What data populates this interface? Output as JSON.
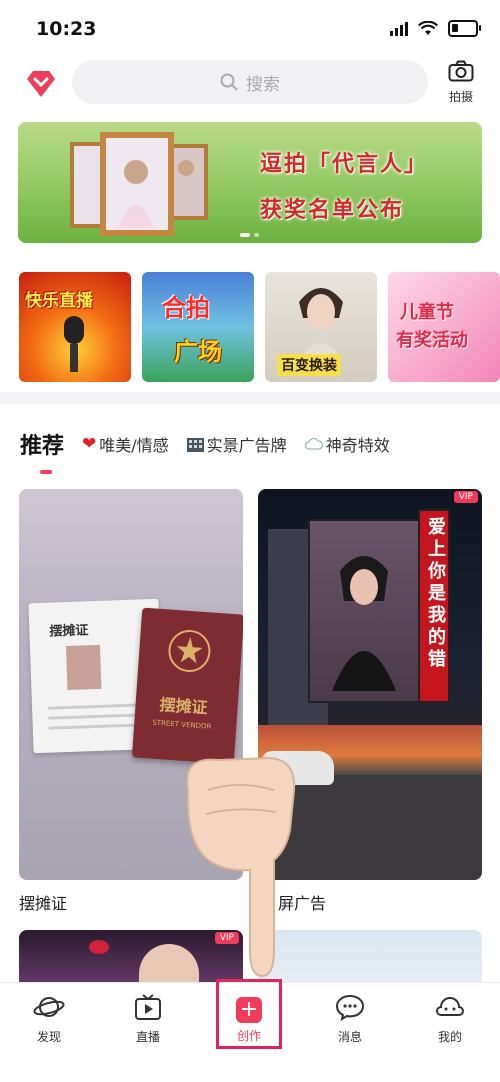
{
  "status": {
    "time": "10:23"
  },
  "header": {
    "search_placeholder": "搜索",
    "camera_label": "拍摄"
  },
  "banner": {
    "line1": "逗拍「代言人」",
    "line2": "获奖名单公布"
  },
  "tiles": [
    {
      "line1": "快乐直播",
      "line2": ""
    },
    {
      "line1": "合拍",
      "line2": "广场"
    },
    {
      "line1": "百变换装",
      "line2": ""
    },
    {
      "line1": "儿童节",
      "line2": "有奖活动"
    }
  ],
  "tabs": {
    "recommend": "推荐",
    "items": [
      {
        "label": "唯美/情感",
        "icon": "heart-icon"
      },
      {
        "label": "实景广告牌",
        "icon": "building-icon"
      },
      {
        "label": "神奇特效",
        "icon": "cloud-icon"
      }
    ]
  },
  "cards": [
    {
      "caption": "摆摊证",
      "card_title": "摆摊证",
      "card_sub": "STREET VENDOR"
    },
    {
      "caption": "屏广告",
      "vip": "VIP",
      "billboard_text": "爱上你是我的错"
    },
    {
      "vip": "VIP"
    },
    {}
  ],
  "nav": [
    {
      "label": "发现",
      "icon": "planet-icon"
    },
    {
      "label": "直播",
      "icon": "tv-icon"
    },
    {
      "label": "创作",
      "icon": "plus-icon"
    },
    {
      "label": "消息",
      "icon": "chat-icon"
    },
    {
      "label": "我的",
      "icon": "face-icon"
    }
  ],
  "colors": {
    "accent": "#f03c5a",
    "highlight_box": "#e0245e"
  }
}
